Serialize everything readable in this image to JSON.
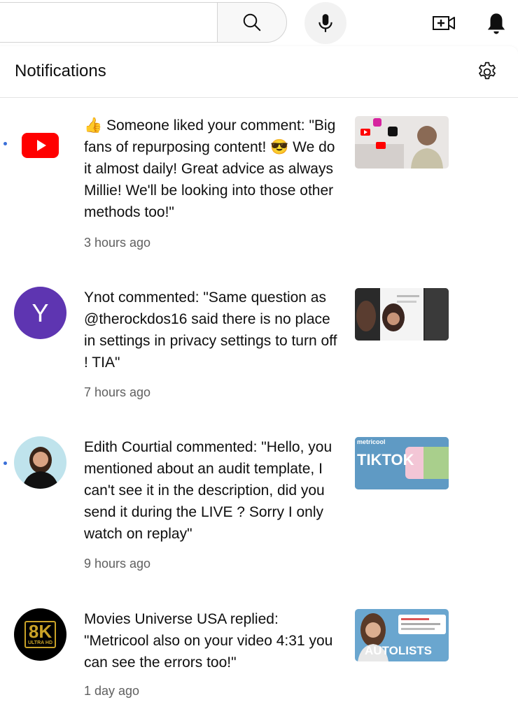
{
  "header": {
    "search_placeholder": "",
    "search_icon": "search-icon",
    "mic_icon": "microphone-icon",
    "create_icon": "video-create-icon",
    "bell_icon": "bell-icon"
  },
  "panel": {
    "title": "Notifications",
    "settings_icon": "gear-icon"
  },
  "notifications": [
    {
      "unread": true,
      "avatar": "youtube-logo",
      "text": "👍 Someone liked your comment: \"Big fans of repurposing content! 😎 We do it almost daily! Great advice as always Millie! We'll be looking into those other methods too!\"",
      "time": "3 hours ago",
      "thumbnail": "video-thumbnail"
    },
    {
      "unread": false,
      "avatar_letter": "Y",
      "avatar_color": "#5e35b1",
      "text": "Ynot commented: \"Same question as @therockdos16 said there is no place in settings in privacy settings to turn off ! TIA\"",
      "time": "7 hours ago",
      "thumbnail": "video-thumbnail"
    },
    {
      "unread": true,
      "avatar": "user-photo",
      "text": "Edith Courtial commented: \"Hello, you mentioned about an audit template, I can't see it in the description, did you send it during the LIVE ? Sorry I only watch on replay\"",
      "time": "9 hours ago",
      "thumbnail": "video-thumbnail",
      "thumb_brand": "metricool",
      "thumb_word": "TIKTOK"
    },
    {
      "unread": false,
      "avatar_text": "8K",
      "avatar_subtext": "ULTRA HD",
      "text": "Movies Universe USA replied: \"Metricool also on your video 4:31 you can see the errors too!\"",
      "time": "1 day ago",
      "thumbnail": "video-thumbnail",
      "thumb_word": "AUTOLISTS"
    }
  ],
  "colors": {
    "youtube_red": "#ff0000",
    "unread_dot": "#3a6fd8",
    "secondary_text": "#606060",
    "divider": "#e3e3e3"
  }
}
